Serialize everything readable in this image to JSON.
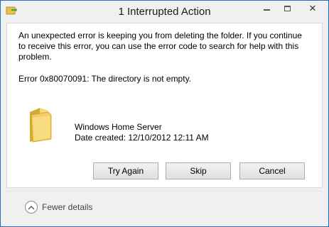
{
  "window": {
    "title": "1 Interrupted Action",
    "close_glyph": "✕"
  },
  "message": {
    "text": "An unexpected error is keeping you from deleting the folder. If you continue to receive this error, you can use the error code to search for help with this problem.",
    "error": "Error 0x80070091: The directory is not empty."
  },
  "item": {
    "name": "Windows Home Server",
    "date": "Date created: 12/10/2012 12:11 AM"
  },
  "buttons": {
    "try_again": "Try Again",
    "skip": "Skip",
    "cancel": "Cancel"
  },
  "footer": {
    "details_label": "Fewer details"
  },
  "colors": {
    "border_accent": "#1f6fbf",
    "chrome_bg": "#f0f0f0"
  },
  "icons": [
    "file-operation-icon",
    "folder-icon",
    "chevron-up-icon",
    "minimize-icon",
    "maximize-icon",
    "close-icon"
  ]
}
